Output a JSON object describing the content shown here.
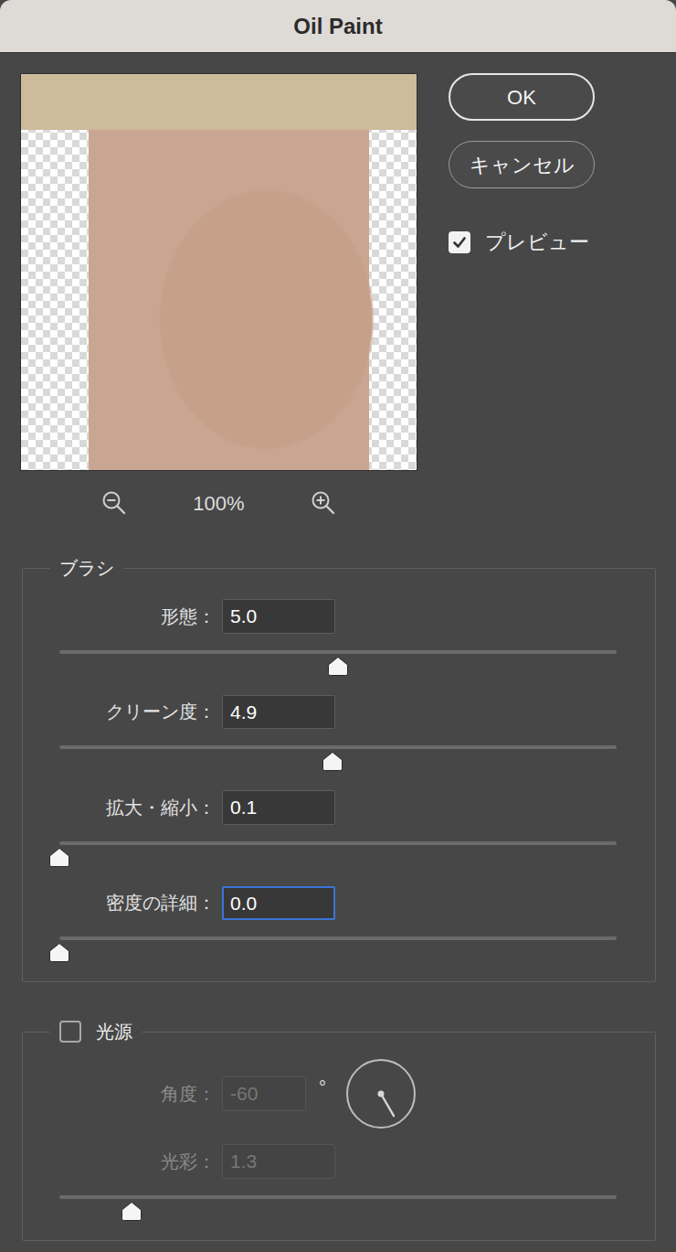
{
  "window": {
    "title": "Oil Paint"
  },
  "preview": {
    "zoom": "100%"
  },
  "buttons": [
    {
      "label": "OK",
      "default": true
    },
    {
      "label": "キャンセル",
      "default": false
    }
  ],
  "preview_toggle": {
    "label": "プレビュー",
    "checked": true
  },
  "brush": {
    "title": "ブラシ",
    "params": [
      {
        "label": "形態：",
        "value": "5.0",
        "level": 0.5,
        "focused": false
      },
      {
        "label": "クリーン度：",
        "value": "4.9",
        "level": 0.49,
        "focused": false
      },
      {
        "label": "拡大・縮小：",
        "value": "0.1",
        "level": 0,
        "focused": false
      },
      {
        "label": "密度の詳細：",
        "value": "0.0",
        "level": 0,
        "focused": true
      }
    ]
  },
  "lighting": {
    "title": "光源",
    "checked": false,
    "angle": {
      "label": "角度：",
      "value": "-60",
      "unit": "°",
      "disabled": true,
      "degrees": -60
    },
    "shine": {
      "label": "光彩：",
      "value": "1.3",
      "disabled": true,
      "level": 0.13
    }
  }
}
